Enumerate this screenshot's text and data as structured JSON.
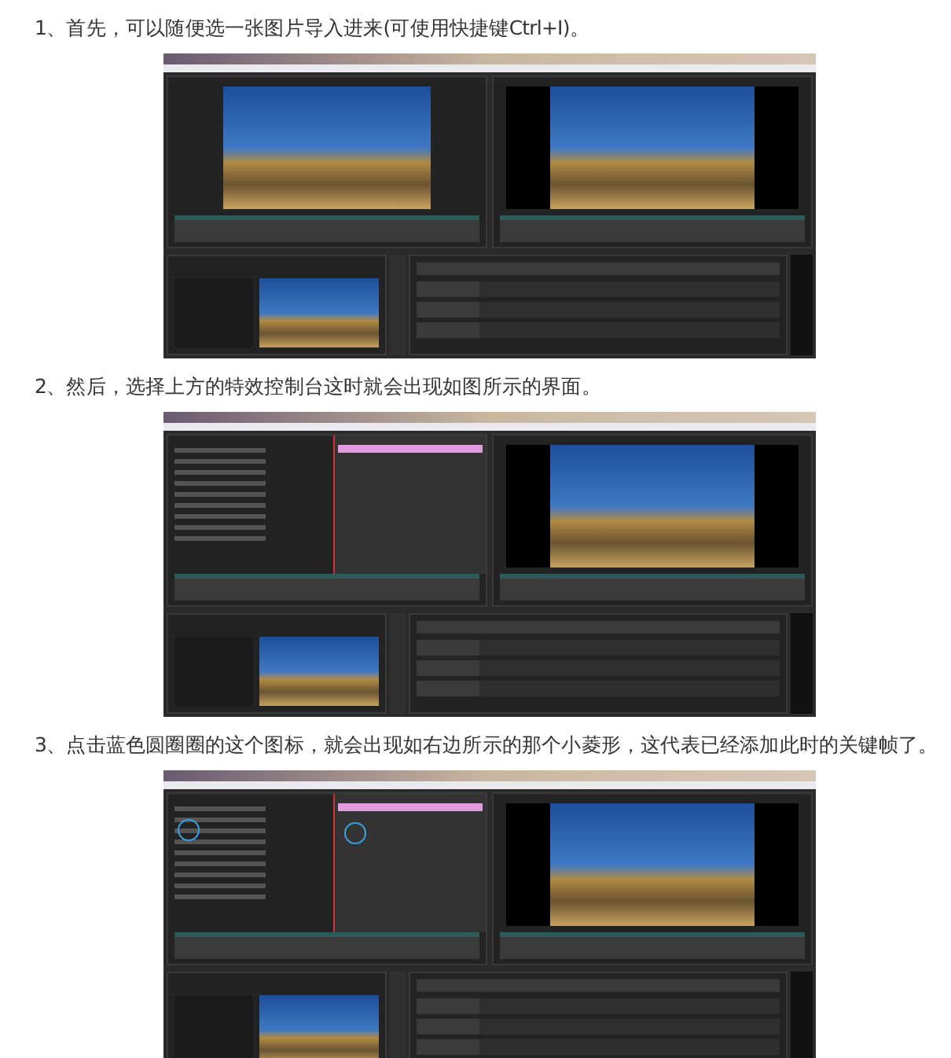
{
  "steps": [
    {
      "text": "1、首先，可以随便选一张图片导入进来(可使用快捷键Ctrl+I)。",
      "kind": "monitors"
    },
    {
      "text": "2、然后，选择上方的特效控制台这时就会出现如图所示的界面。",
      "kind": "effects"
    },
    {
      "text": "3、点击蓝色圆圈圈的这个图标，就会出现如右边所示的那个小菱形，这代表已经添加此时的关键帧了。",
      "kind": "keyframe"
    }
  ]
}
